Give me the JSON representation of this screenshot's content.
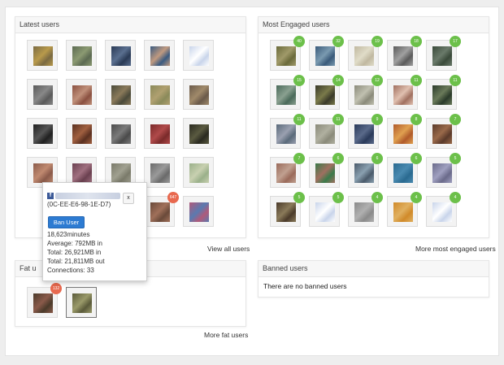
{
  "latest_users": {
    "title": "Latest users",
    "link": "View all users",
    "rows": [
      [
        {
          "colors": [
            "#7a6a42",
            "#b89a4b"
          ],
          "badge": ""
        },
        {
          "colors": [
            "#5c6a52",
            "#8b9a72"
          ],
          "badge": ""
        },
        {
          "colors": [
            "#2a3a55",
            "#5a6f8f"
          ],
          "badge": ""
        },
        {
          "colors": [
            "#3a5a80",
            "#c09a80"
          ],
          "badge": ""
        },
        {
          "colors": [
            "#c8d4ea",
            "#ffffff"
          ],
          "badge": ""
        }
      ],
      [
        {
          "colors": [
            "#5a5a5a",
            "#888888"
          ],
          "badge": ""
        },
        {
          "colors": [
            "#8a5040",
            "#c0907a"
          ],
          "badge": ""
        },
        {
          "colors": [
            "#4a4a3a",
            "#8a7a5a"
          ],
          "badge": ""
        },
        {
          "colors": [
            "#8a8a5a",
            "#b0a070"
          ],
          "badge": ""
        },
        {
          "colors": [
            "#6a5a4a",
            "#a08a6a"
          ],
          "badge": ""
        }
      ],
      [
        {
          "colors": [
            "#202020",
            "#555555"
          ],
          "badge": ""
        },
        {
          "colors": [
            "#5a3020",
            "#a06040"
          ],
          "badge": ""
        },
        {
          "colors": [
            "#4a4a4a",
            "#7a7a7a"
          ],
          "badge": ""
        },
        {
          "colors": [
            "#7a2a2a",
            "#b04a4a"
          ],
          "badge": ""
        },
        {
          "colors": [
            "#2a2a20",
            "#5a5a40"
          ],
          "badge": ""
        }
      ],
      [
        {
          "colors": [
            "#8a5a4a",
            "#c08a70"
          ],
          "badge": ""
        },
        {
          "colors": [
            "#6a4050",
            "#a07080"
          ],
          "badge": ""
        },
        {
          "colors": [
            "#7a7a6a",
            "#a0a090"
          ],
          "badge": ""
        },
        {
          "colors": [
            "#6a6a6a",
            "#9a9a9a"
          ],
          "badge": ""
        },
        {
          "colors": [
            "#9ab08a",
            "#c8d0b0"
          ],
          "badge": ""
        }
      ],
      [
        {
          "colors": [
            "#000000",
            "#000000"
          ],
          "badge": ""
        },
        {
          "colors": [
            "#000000",
            "#000000"
          ],
          "badge": ""
        },
        {
          "colors": [
            "#000000",
            "#000000"
          ],
          "badge": ""
        },
        {
          "colors": [
            "#6a4a3a",
            "#a0705a"
          ],
          "badge": "647"
        },
        {
          "colors": [
            "#b05a7a",
            "#5a7ab0"
          ],
          "badge": ""
        }
      ]
    ]
  },
  "most_engaged": {
    "title": "Most Engaged users",
    "link": "More most engaged users",
    "rows": [
      [
        {
          "colors": [
            "#6a6a3a",
            "#a09a6a"
          ],
          "badge": "40"
        },
        {
          "colors": [
            "#3a5a7a",
            "#7a9ab0"
          ],
          "badge": "32"
        },
        {
          "colors": [
            "#c0b8a0",
            "#e0dcc8"
          ],
          "badge": "19"
        },
        {
          "colors": [
            "#5a5a5a",
            "#a0a0a0"
          ],
          "badge": "18"
        },
        {
          "colors": [
            "#3a4a3a",
            "#6a7a6a"
          ],
          "badge": "17"
        }
      ],
      [
        {
          "colors": [
            "#4a6a5a",
            "#8aa090"
          ],
          "badge": "15"
        },
        {
          "colors": [
            "#3a3a2a",
            "#7a7a4a"
          ],
          "badge": "14"
        },
        {
          "colors": [
            "#8a8a7a",
            "#c0c0b0"
          ],
          "badge": "12"
        },
        {
          "colors": [
            "#a07060",
            "#e0c0b0"
          ],
          "badge": "11"
        },
        {
          "colors": [
            "#2a3a2a",
            "#6a7a5a"
          ],
          "badge": "11"
        }
      ],
      [
        {
          "colors": [
            "#5a6a7a",
            "#9aa0b0"
          ],
          "badge": "11"
        },
        {
          "colors": [
            "#8a8a7a",
            "#b0b0a0"
          ],
          "badge": "11"
        },
        {
          "colors": [
            "#2a3a5a",
            "#5a6a8a"
          ],
          "badge": "9"
        },
        {
          "colors": [
            "#b05a2a",
            "#e0a050"
          ],
          "badge": "8"
        },
        {
          "colors": [
            "#5a3a2a",
            "#9a6a4a"
          ],
          "badge": "7"
        }
      ],
      [
        {
          "colors": [
            "#9a6a5a",
            "#c0a090"
          ],
          "badge": "7"
        },
        {
          "colors": [
            "#3a7a4a",
            "#a07060"
          ],
          "badge": "6"
        },
        {
          "colors": [
            "#4a5a6a",
            "#8aa0b0"
          ],
          "badge": "6"
        },
        {
          "colors": [
            "#2a6a90",
            "#4a8ab0"
          ],
          "badge": "6"
        },
        {
          "colors": [
            "#6a6a8a",
            "#a0a0c0"
          ],
          "badge": "5"
        }
      ],
      [
        {
          "colors": [
            "#4a3a2a",
            "#8a7a5a"
          ],
          "badge": "5"
        },
        {
          "colors": [
            "#c8d4ea",
            "#ffffff"
          ],
          "badge": "5"
        },
        {
          "colors": [
            "#8a8a8a",
            "#b0b0b0"
          ],
          "badge": "4"
        },
        {
          "colors": [
            "#d08a2a",
            "#e0b060"
          ],
          "badge": "4"
        },
        {
          "colors": [
            "#c8d4ea",
            "#ffffff"
          ],
          "badge": "4"
        }
      ]
    ]
  },
  "fat_users": {
    "title_visible": "Fat u",
    "link": "More fat users",
    "tiles": [
      {
        "colors": [
          "#4a3a2a",
          "#8a5a4a"
        ],
        "badge": "132",
        "selected": false
      },
      {
        "colors": [
          "#5a5a3a",
          "#9a9a6a"
        ],
        "badge": "",
        "selected": true
      }
    ]
  },
  "banned_users": {
    "title": "Banned users",
    "empty_text": "There are no banned users"
  },
  "popup": {
    "mac": "(0C-EE-E6-98-1E-D7)",
    "close_label": "x",
    "ban_label": "Ban User",
    "stats": [
      "18,623minutes",
      "Average: 792MB in",
      "Total: 26,921MB in",
      "Total: 21,811MB out",
      "Connections: 33"
    ]
  },
  "colors": {
    "badge_green": "#6cc04a",
    "badge_red": "#e8694f",
    "button_blue": "#2d7bd2",
    "facebook_blue": "#3b5998"
  },
  "icons": {
    "facebook": "facebook-icon",
    "close": "close-icon"
  }
}
